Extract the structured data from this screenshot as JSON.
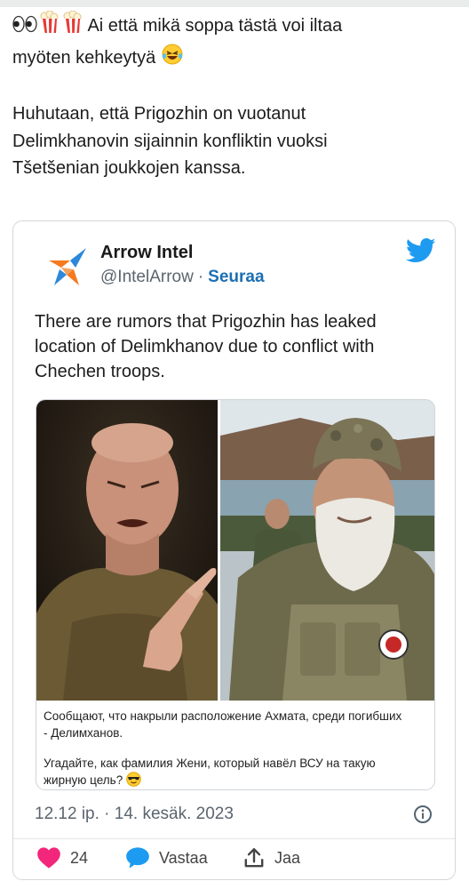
{
  "post": {
    "line1": "Ai että mikä soppa tästä voi iltaa",
    "line2": "myöten kehkeytyä",
    "para2_line1": "Huhutaan, että Prigozhin on vuotanut",
    "para2_line2": "Delimkhanovin sijainnin konfliktin vuoksi",
    "para2_line3": "Tšetšenian joukkojen kanssa.",
    "icons": [
      "eyes-emoji",
      "popcorn-emoji",
      "popcorn-emoji",
      "rolling-laughing-emoji"
    ]
  },
  "tweet": {
    "author_name": "Arrow Intel",
    "handle": "@IntelArrow",
    "separator": "·",
    "follow_label": "Seuraa",
    "text_line1": "There are rumors that Prigozhin has leaked",
    "text_line2": "location of Delimkhanov due to conflict with",
    "text_line3": "Chechen troops.",
    "caption_line1": "Сообщают, что накрыли расположение Ахмата, среди погибших",
    "caption_line2": "- Делимханов.",
    "caption_line3": "Угадайте, как фамилия Жени, который навёл ВСУ на такую",
    "caption_line4": "жирную цель?",
    "timestamp": "12.12 ip. · 14. kesäk. 2023",
    "likes": "24",
    "reply_label": "Vastaa",
    "share_label": "Jaa"
  },
  "colors": {
    "link": "#1d6fb3",
    "twitter_blue": "#1d9bf0",
    "like_pink": "#f2267a",
    "handle_gray": "#5a656f"
  }
}
